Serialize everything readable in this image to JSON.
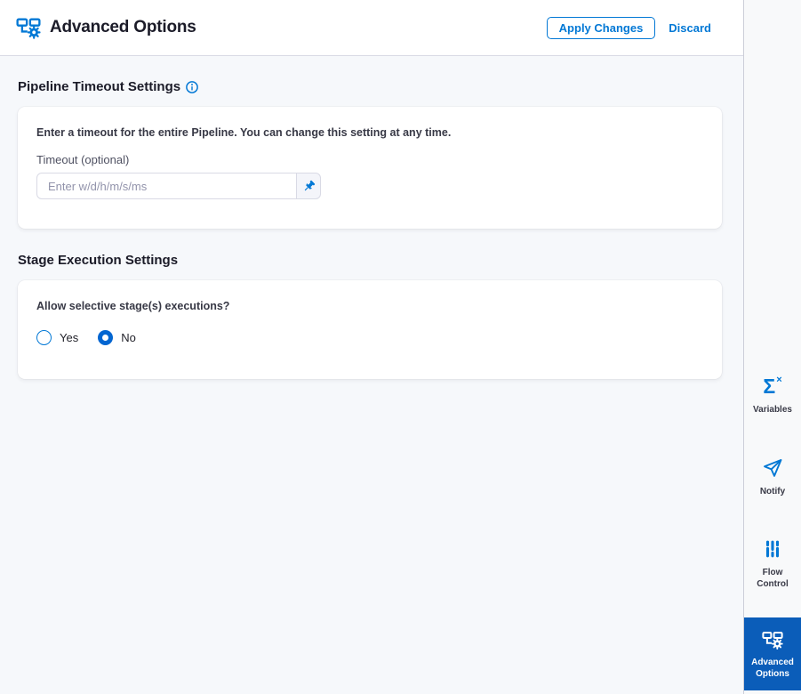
{
  "header": {
    "title": "Advanced Options",
    "apply_label": "Apply Changes",
    "discard_label": "Discard"
  },
  "sections": {
    "timeout": {
      "heading": "Pipeline Timeout Settings",
      "description": "Enter a timeout for the entire Pipeline. You can change this setting at any time.",
      "field_label": "Timeout (optional)",
      "value": "",
      "placeholder": "Enter w/d/h/m/s/ms"
    },
    "stage": {
      "heading": "Stage Execution Settings",
      "question": "Allow selective stage(s) executions?",
      "options": [
        {
          "label": "Yes",
          "selected": false
        },
        {
          "label": "No",
          "selected": true
        }
      ]
    }
  },
  "sidebar": {
    "items": [
      {
        "label": "Variables",
        "icon": "sigma-x-icon",
        "active": false
      },
      {
        "label": "Notify",
        "icon": "paper-plane-icon",
        "active": false
      },
      {
        "label": "Flow Control",
        "icon": "sliders-icon",
        "active": false
      },
      {
        "label": "Advanced Options",
        "icon": "pipeline-gear-icon",
        "active": true
      }
    ]
  },
  "colors": {
    "accent": "#0278d5",
    "active_tile_background": "#0b5db9",
    "content_background": "#f6f8fb"
  }
}
